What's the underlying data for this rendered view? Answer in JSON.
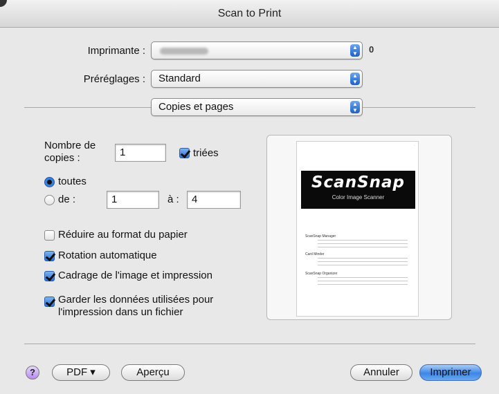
{
  "window": {
    "title": "Scan to Print"
  },
  "printer": {
    "label": "Imprimante :",
    "info_glyph": "0"
  },
  "presets": {
    "label": "Préréglages :",
    "value": "Standard"
  },
  "panel": {
    "value": "Copies et pages"
  },
  "copies": {
    "label_line1": "Nombre de",
    "label_line2": "copies :",
    "value": "1",
    "collate_label": "triées",
    "collate_checked": true
  },
  "pages": {
    "all_label": "toutes",
    "range_label": "de :",
    "from": "1",
    "to_label": "à :",
    "to": "4",
    "selected": "all"
  },
  "options": [
    {
      "label": "Réduire au format du papier",
      "checked": false
    },
    {
      "label": "Rotation automatique",
      "checked": true
    },
    {
      "label": "Cadrage de l'image et impression",
      "checked": true
    },
    {
      "label_line1": "Garder les données utilisées pour",
      "label_line2": "l'impression dans un fichier",
      "checked": true
    }
  ],
  "preview": {
    "brand": "ScanSnap",
    "subtitle": "Color Image Scanner",
    "sections": [
      "ScanSnap Manager",
      "Card Minder",
      "ScanSnap Organizer"
    ]
  },
  "buttons": {
    "help": "?",
    "pdf": "PDF ▾",
    "preview": "Aperçu",
    "cancel": "Annuler",
    "print": "Imprimer"
  }
}
